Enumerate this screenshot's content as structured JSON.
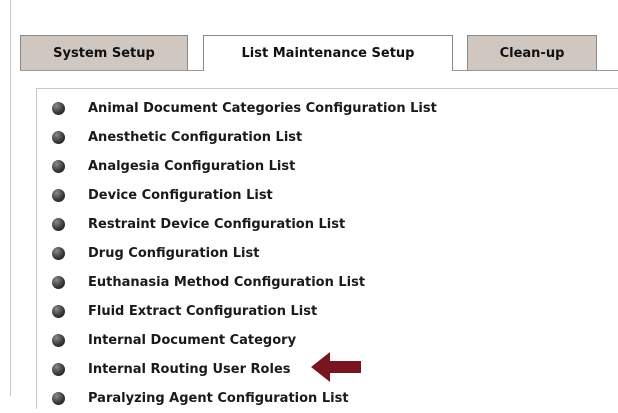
{
  "tabs": [
    {
      "label": "System Setup",
      "active": false
    },
    {
      "label": "List Maintenance Setup",
      "active": true
    },
    {
      "label": "Clean-up",
      "active": false
    }
  ],
  "list": {
    "items": [
      "Animal Document Categories Configuration List",
      "Anesthetic Configuration List",
      "Analgesia Configuration List",
      "Device Configuration List",
      "Restraint Device Configuration List",
      "Drug Configuration List",
      "Euthanasia Method Configuration List",
      "Fluid Extract Configuration List",
      "Internal Document Category",
      "Internal Routing User Roles",
      "Paralyzing Agent Configuration List"
    ]
  },
  "annotation": {
    "arrow_color": "#7a1420",
    "points_to": "Internal Routing User Roles",
    "icon": "left-arrow-icon"
  },
  "colors": {
    "inactive_tab": "#d0c7c1",
    "active_tab": "#ffffff",
    "bullet": "#3a3a3a"
  }
}
